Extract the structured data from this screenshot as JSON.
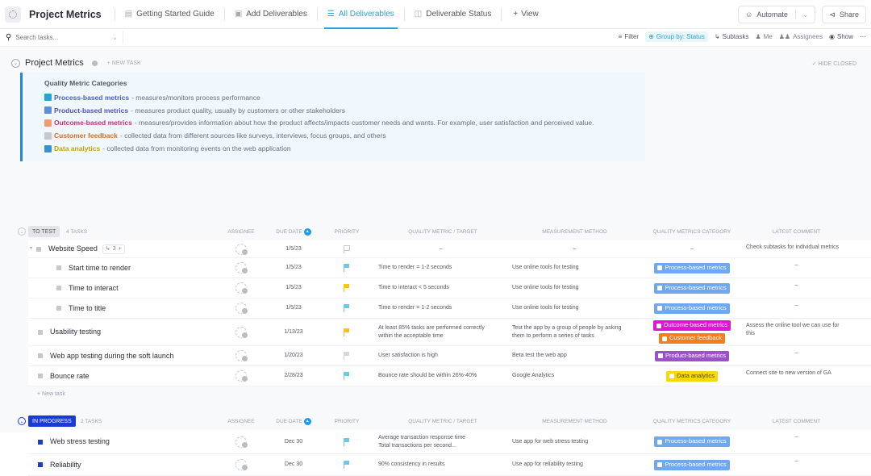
{
  "app": {
    "title": "Project Metrics",
    "tabs": [
      {
        "label": "Getting Started Guide",
        "icon": "doc-icon",
        "active": false
      },
      {
        "label": "Add Deliverables",
        "icon": "form-icon",
        "active": false
      },
      {
        "label": "All Deliverables",
        "icon": "list-icon",
        "active": true
      },
      {
        "label": "Deliverable Status",
        "icon": "board-icon",
        "active": false
      }
    ],
    "add_view_label": "View",
    "automate_label": "Automate",
    "share_label": "Share"
  },
  "toolbar": {
    "search_placeholder": "Search tasks...",
    "filter_label": "Filter",
    "group_by_label": "Group by: Status",
    "subtasks_label": "Subtasks",
    "me_label": "Me",
    "assignees_label": "Assignees",
    "show_label": "Show",
    "more_label": "···"
  },
  "list": {
    "title": "Project Metrics",
    "new_task_label": "+ NEW TASK",
    "hide_closed_label": "✓ HIDE CLOSED",
    "description": {
      "title": "Quality Metric Categories",
      "items": [
        {
          "name": "Process-based metrics",
          "text": " - measures/monitors process performance",
          "color": "#4b5fc9",
          "icon_color": "#2ba2d6"
        },
        {
          "name": "Product-based metrics",
          "text": " - measures product quality, usually by  customers or other stakeholders",
          "color": "#5a4fc2",
          "icon_color": "#5b8fd6"
        },
        {
          "name": "Outcome-based metrics",
          "text": " - measures/provides information about how the product affects/impacts customer needs and wants. For example, user satisfaction and perceived value.",
          "color": "#c2336f",
          "icon_color": "#f29a70"
        },
        {
          "name": "Customer feedback",
          "text": " - collected data from different sources like surveys, interviews, focus groups, and others",
          "color": "#d2702a",
          "icon_color": "#c5c8ce"
        },
        {
          "name": "Data analytics",
          "text": " - collected data from monitoring events on the web application",
          "color": "#c8a10a",
          "icon_color": "#3a8fd6"
        }
      ]
    }
  },
  "columns": {
    "assignee": "ASSIGNEE",
    "due_date": "DUE DATE",
    "priority": "PRIORITY",
    "metric": "QUALITY METRIC / TARGET",
    "method": "MEASUREMENT METHOD",
    "category": "QUALITY METRICS CATEGORY",
    "comment": "LATEST COMMENT"
  },
  "categories": {
    "process": {
      "label": "Process-based metrics",
      "color": "#6fa8f0"
    },
    "outcome": {
      "label": "Outcome-based metrics",
      "color": "#e213d6"
    },
    "feedback": {
      "label": "Customer feedback",
      "color": "#f57c1f"
    },
    "product": {
      "label": "Product-based metrics",
      "color": "#9b51c9"
    },
    "analytics": {
      "label": "Data analytics",
      "color": "#f5d90a",
      "text_color": "#5a4a00"
    }
  },
  "groups": [
    {
      "status": "TO TEST",
      "count_label": "4 TASKS",
      "badge_bg": "#e3e4e8",
      "badge_color": "#545861",
      "new_task_label": "+ New task",
      "tasks": [
        {
          "name": "Website Speed",
          "subtask_count": "3",
          "due": "1/5/23",
          "priority": "none",
          "metric": "–",
          "method": "–",
          "categories_placeholder": "–",
          "comment": "Check subtasks for individual metrics"
        },
        {
          "name": "Start time to render",
          "due": "1/5/23",
          "priority": "low",
          "metric": "Time to render = 1-2 seconds",
          "method": "Use online tools for testing",
          "categories": [
            "process"
          ],
          "comment": "–"
        },
        {
          "name": "Time to interact",
          "due": "1/5/23",
          "priority": "high",
          "metric": "Time to interact < 5 seconds",
          "method": "Use online tools for testing",
          "categories": [
            "process"
          ],
          "comment": "–"
        },
        {
          "name": "Time to title",
          "due": "1/5/23",
          "priority": "low",
          "metric": "Time to render = 1-2 seconds",
          "method": "Use online tools for testing",
          "categories": [
            "process"
          ],
          "comment": "–"
        },
        {
          "name": "Usability testing",
          "due": "1/13/23",
          "priority": "high",
          "metric": "At least 85% tasks are performed correctly within the acceptable time",
          "method": "Test the app by a group of people by asking them to perform a series of tasks",
          "categories": [
            "outcome",
            "feedback"
          ],
          "comment": "Assess the online tool we can use for this"
        },
        {
          "name": "Web app testing during the soft launch",
          "due": "1/20/23",
          "priority": "none-filled",
          "metric": "User satisfaction is high",
          "method": "Beta test the web app",
          "categories": [
            "product"
          ],
          "comment": "–"
        },
        {
          "name": "Bounce rate",
          "due": "2/28/23",
          "priority": "low",
          "metric": "Bounce rate should be within 26%-40%",
          "method": "Google Analytics",
          "categories": [
            "analytics"
          ],
          "comment": "Connect site to new version of GA"
        }
      ]
    },
    {
      "status": "IN PROGRESS",
      "count_label": "2 TASKS",
      "badge_bg": "#1a3bd1",
      "badge_color": "#ffffff",
      "tasks": [
        {
          "name": "Web stress testing",
          "due": "Dec 30",
          "priority": "low",
          "metric": "Average transaction response time\nTotal transactions per second...",
          "method": "Use app for web stress testing",
          "categories": [
            "process"
          ],
          "comment": "–"
        },
        {
          "name": "Reliability",
          "due": "Dec 30",
          "priority": "low",
          "metric": "90% consistency in results",
          "method": "Use app for reliability testing",
          "categories": [
            "process"
          ],
          "comment": "–"
        }
      ]
    }
  ],
  "priority_colors": {
    "low": "#6fc8e8",
    "high": "#f5c518",
    "none": "#c5c8ce",
    "none-filled": "#d5d7dc"
  }
}
